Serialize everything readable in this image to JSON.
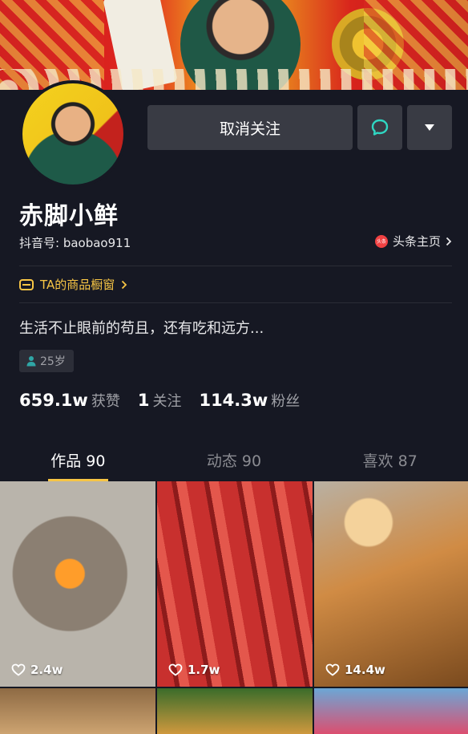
{
  "profile": {
    "nickname": "赤脚小鲜",
    "douyin_id": "抖音号: baobao911",
    "toutiao_link": "头条主页",
    "toutiao_badge": "头条",
    "shop_window": "TA的商品橱窗",
    "bio": "生活不止眼前的苟且，还有吃和远方...",
    "age": "25岁"
  },
  "actions": {
    "unfollow_label": "取消关注"
  },
  "stats": {
    "likes_value": "659.1w",
    "likes_label": "获赞",
    "following_value": "1",
    "following_label": "关注",
    "followers_value": "114.3w",
    "followers_label": "粉丝"
  },
  "tabs": [
    {
      "label": "作品 90",
      "active": true
    },
    {
      "label": "动态 90",
      "active": false
    },
    {
      "label": "喜欢 87",
      "active": false
    }
  ],
  "videos": [
    {
      "likes": "2.4w"
    },
    {
      "likes": "1.7w"
    },
    {
      "likes": "14.4w"
    }
  ],
  "colors": {
    "background": "#161823",
    "button": "#393b44",
    "accent_yellow": "#f7c545",
    "message_icon": "#2fd6c2",
    "toutiao_red": "#f04142"
  },
  "icons": {
    "message": "chat-bubble-icon",
    "more": "triangle-down-icon",
    "shop": "shop-window-icon",
    "age": "person-icon",
    "like": "heart-outline-icon",
    "chevron": "chevron-right-icon"
  }
}
